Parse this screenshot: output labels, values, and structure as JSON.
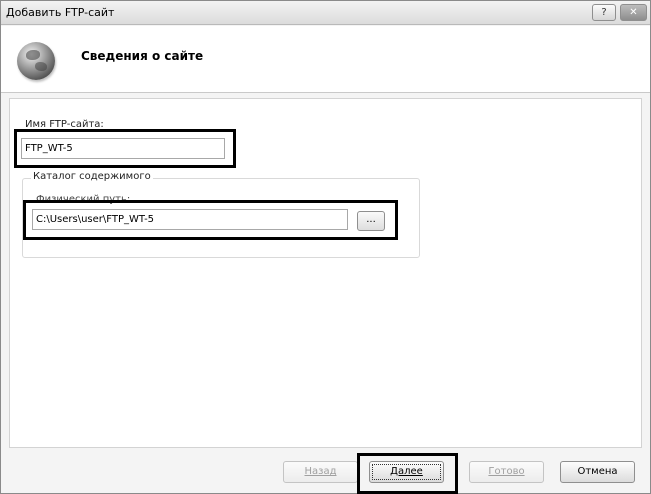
{
  "window": {
    "title": "Добавить FTP-сайт",
    "help_label": "?",
    "close_label": "✕"
  },
  "header": {
    "title": "Сведения о сайте",
    "icon": "globe-icon"
  },
  "form": {
    "site_name_label": "Имя FTP-сайта:",
    "site_name_value": "FTP_WT-5",
    "content_dir_legend": "Каталог содержимого",
    "physical_path_label": "Физический путь:",
    "physical_path_value": "C:\\Users\\user\\FTP_WT-5",
    "browse_label": "..."
  },
  "footer": {
    "back": {
      "label": "Назад",
      "enabled": false
    },
    "next": {
      "label": "Далее",
      "enabled": true
    },
    "finish": {
      "label": "Готово",
      "enabled": false
    },
    "cancel": {
      "label": "Отмена",
      "enabled": true
    }
  }
}
